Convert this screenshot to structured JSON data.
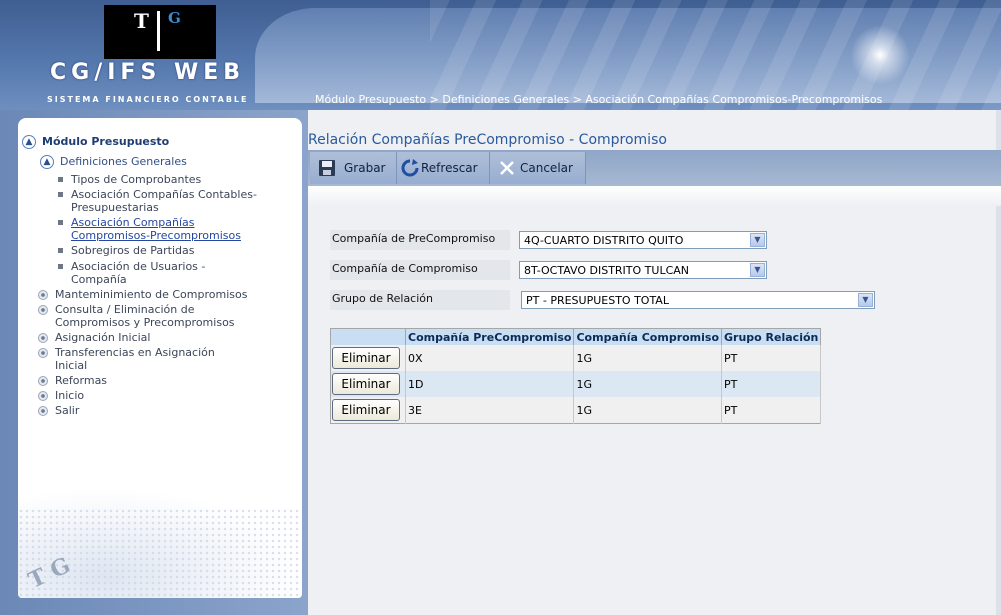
{
  "header": {
    "logo_t": "T",
    "logo_g": "G",
    "app_title": "CG/IFS  WEB",
    "app_subtitle": "SISTEMA FINANCIERO CONTABLE",
    "breadcrumb": "Módulo Presupuesto > Definiciones Generales > Asociación Compañías Compromisos-Precompromisos"
  },
  "sidebar": {
    "module_title": "Módulo Presupuesto",
    "section_title": "Definiciones Generales",
    "sub_items": [
      {
        "label": "Tipos de Comprobantes"
      },
      {
        "label": "Asociación Compañías Contables-Presupuestarias"
      },
      {
        "label": "Asociación Compañías Compromisos-Precompromisos",
        "active": true
      },
      {
        "label": "Sobregiros de Partidas"
      },
      {
        "label": "Asociación de Usuarios - Compañía"
      }
    ],
    "items": [
      {
        "label": "Manteminimiento de Compromisos"
      },
      {
        "label": "Consulta / Eliminación de Compromisos y Precompromisos"
      },
      {
        "label": "Asignación Inicial"
      },
      {
        "label": "Transferencias en Asignación Inicial"
      },
      {
        "label": "Reformas"
      },
      {
        "label": "Inicio"
      },
      {
        "label": "Salir"
      }
    ],
    "footer_logo": "T G"
  },
  "main": {
    "title": "Relación Compañías PreCompromiso - Compromiso",
    "toolbar": {
      "save_label": "Grabar",
      "refresh_label": "Refrescar",
      "cancel_label": "Cancelar"
    },
    "form": {
      "precompromiso_label": "Compañía de PreCompromiso",
      "precompromiso_value": "4Q-CUARTO DISTRITO QUITO",
      "compromiso_label": "Compañía de Compromiso",
      "compromiso_value": "8T-OCTAVO DISTRITO TULCAN",
      "grupo_label": "Grupo de Relación",
      "grupo_value": "PT - PRESUPUESTO TOTAL"
    },
    "grid": {
      "columns": [
        "",
        "Compañía PreCompromiso",
        "Compañía Compromiso",
        "Grupo Relación"
      ],
      "delete_label": "Eliminar",
      "rows": [
        {
          "pre": "0X",
          "comp": "1G",
          "grupo": "PT"
        },
        {
          "pre": "1D",
          "comp": "1G",
          "grupo": "PT"
        },
        {
          "pre": "3E",
          "comp": "1G",
          "grupo": "PT"
        }
      ]
    }
  },
  "colors": {
    "header_blue": "#5477ad",
    "title_blue": "#2a5a9c",
    "grid_header": "#c9def2"
  }
}
